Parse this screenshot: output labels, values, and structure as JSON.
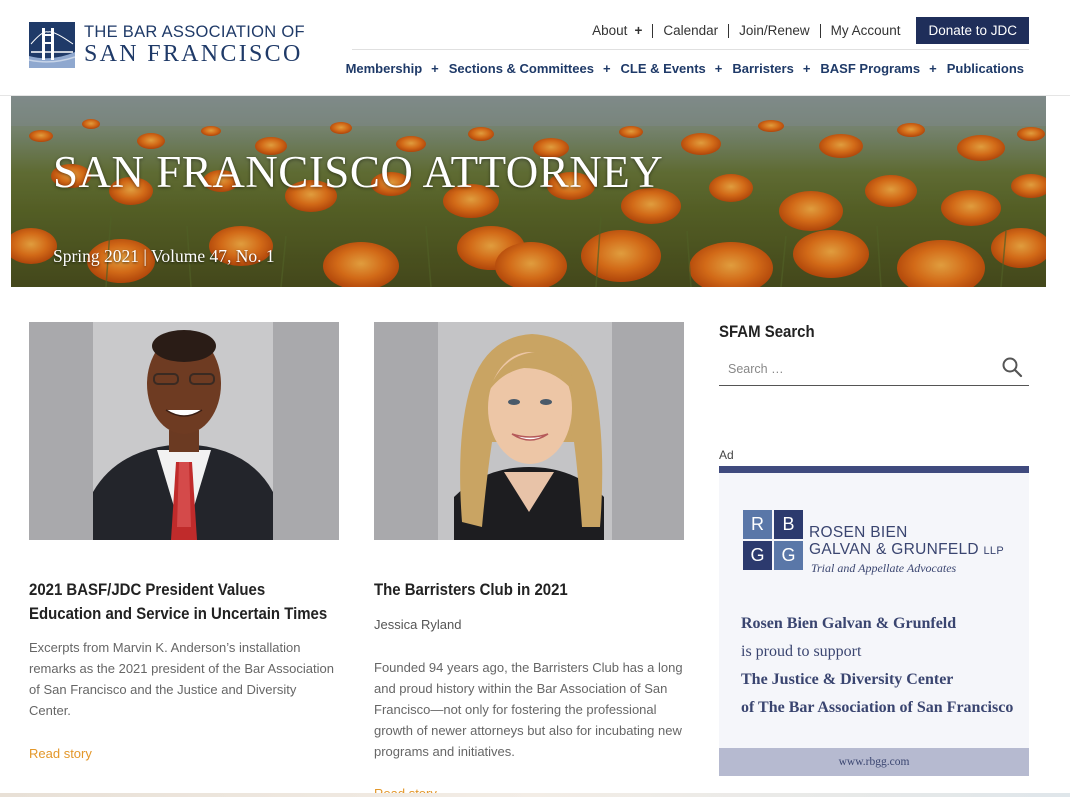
{
  "brand": {
    "line1": "THE BAR ASSOCIATION OF",
    "line2": "SAN FRANCISCO",
    "color": "#1f3a68"
  },
  "topnav": {
    "items": [
      "About",
      "Calendar",
      "Join/Renew",
      "My Account"
    ],
    "plus": "+",
    "donate": "Donate to JDC"
  },
  "mainnav": {
    "items": [
      "Membership",
      "Sections & Committees",
      "CLE & Events",
      "Barristers",
      "BASF Programs",
      "Publications"
    ],
    "plus": "+"
  },
  "hero": {
    "title": "SAN FRANCISCO ATTORNEY",
    "subtitle": "Spring 2021 | Volume 47, No. 1"
  },
  "articles": [
    {
      "title": "2021 BASF/JDC President Values Education and Service in Uncertain Times",
      "author": "",
      "excerpt": "Excerpts from Marvin K. Anderson’s installation remarks as the 2021 president of the Bar Association of San Francisco and the Justice and Diversity Center.",
      "read": "Read story"
    },
    {
      "title": "The Barristers Club in 2021",
      "author": "Jessica Ryland",
      "excerpt": "Founded 94 years ago, the Barristers Club has a long and proud history within the Bar Association of San Francisco—not only for fostering the professional growth of newer attorneys but also for incubating new programs and initiatives.",
      "read": "Read story"
    }
  ],
  "sidebar": {
    "search_title": "SFAM Search",
    "search_placeholder": "Search …",
    "ad_label": "Ad",
    "ad": {
      "grid_letters": [
        "R",
        "B",
        "G",
        "G"
      ],
      "firm_line1": "ROSEN BIEN",
      "firm_line2": "GALVAN & GRUNFELD",
      "firm_llp": "LLP",
      "tagline": "Trial and Appellate Advocates",
      "msg1": "Rosen Bien Galvan & Grunfeld",
      "msg2": "is proud to support",
      "msg3": "The Justice & Diversity Center",
      "msg4": "of The Bar Association of San Francisco",
      "url": "www.rbgg.com"
    }
  },
  "colors": {
    "accent_link": "#e3972a",
    "navy": "#1f2e5a"
  }
}
